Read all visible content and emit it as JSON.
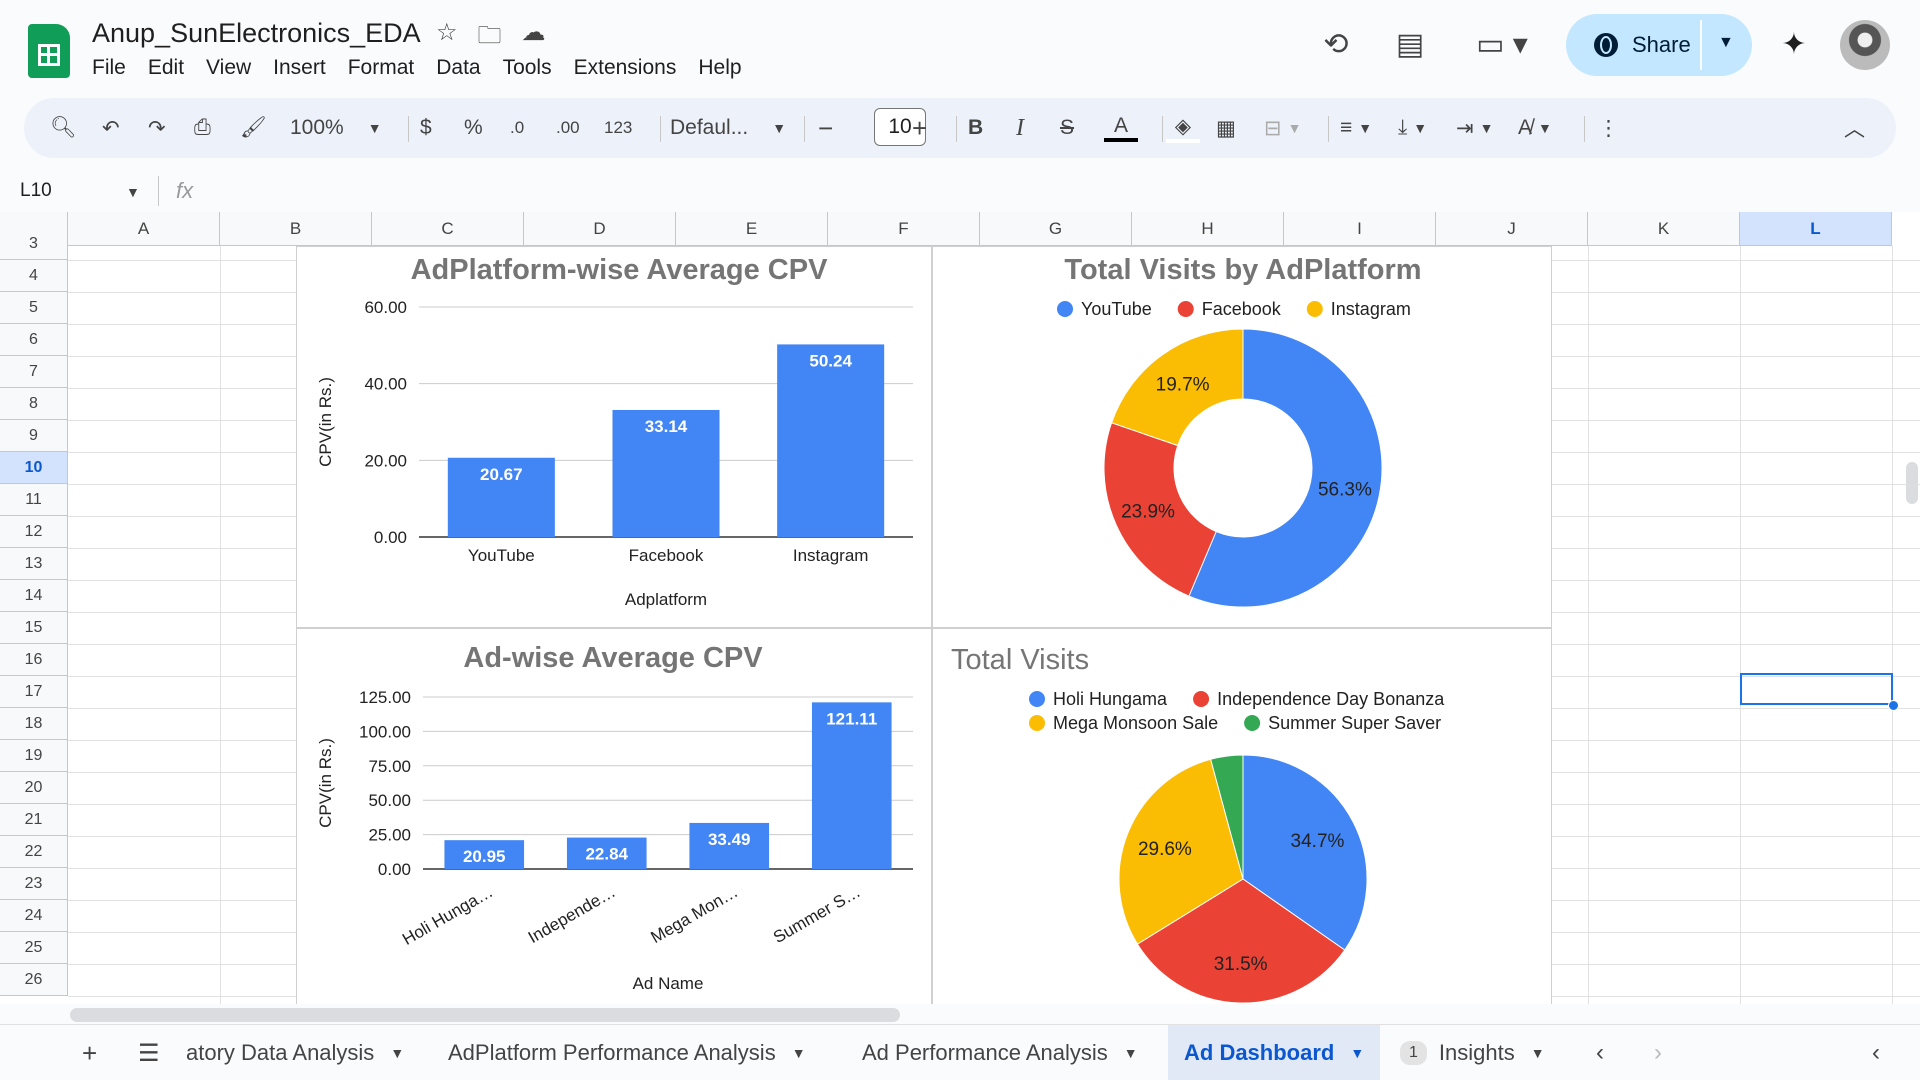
{
  "app": {
    "title": "Anup_SunElectronics_EDA",
    "menu": [
      "File",
      "Edit",
      "View",
      "Insert",
      "Format",
      "Data",
      "Tools",
      "Extensions",
      "Help"
    ],
    "share_label": "Share"
  },
  "toolbar": {
    "zoom": "100%",
    "currency": "$",
    "percent": "%",
    "dec_decrease": ".0",
    "dec_increase": ".00",
    "number_format": "123",
    "font": "Defaul...",
    "font_size": "10",
    "bold": "B",
    "italic": "I",
    "text_color_icon": "A"
  },
  "formula_bar": {
    "name_box": "L10",
    "fx": "fx"
  },
  "grid": {
    "columns": [
      "A",
      "B",
      "C",
      "D",
      "E",
      "F",
      "G",
      "H",
      "I",
      "J",
      "K",
      "L"
    ],
    "rows": [
      "3",
      "4",
      "5",
      "6",
      "7",
      "8",
      "9",
      "10",
      "11",
      "12",
      "13",
      "14",
      "15",
      "16",
      "17",
      "18",
      "19",
      "20",
      "21",
      "22",
      "23",
      "24",
      "25",
      "26"
    ],
    "active_col": "L",
    "active_row": "10"
  },
  "chart_data": [
    {
      "type": "bar",
      "title": "AdPlatform-wise Average CPV",
      "xlabel": "Adplatform",
      "ylabel": "CPV(in Rs.)",
      "categories": [
        "YouTube",
        "Facebook",
        "Instagram"
      ],
      "values": [
        20.67,
        33.14,
        50.24
      ],
      "value_labels": [
        "20.67",
        "33.14",
        "50.24"
      ],
      "yticks": [
        "0.00",
        "20.00",
        "40.00",
        "60.00"
      ],
      "ylim": [
        0,
        60
      ],
      "color": "#4285f4",
      "grid": true
    },
    {
      "type": "pie",
      "donut": true,
      "title": "Total Visits by AdPlatform",
      "legend_position": "top",
      "labels": [
        "YouTube",
        "Facebook",
        "Instagram"
      ],
      "values": [
        56.3,
        23.9,
        19.7
      ],
      "value_labels": [
        "56.3%",
        "23.9%",
        "19.7%"
      ],
      "colors": [
        "#4285f4",
        "#ea4335",
        "#fbbc04"
      ]
    },
    {
      "type": "bar",
      "title": "Ad-wise Average CPV",
      "xlabel": "Ad Name",
      "ylabel": "CPV(in Rs.)",
      "categories": [
        "Holi Hunga…",
        "Independe…",
        "Mega Mon…",
        "Summer S…"
      ],
      "values": [
        20.95,
        22.84,
        33.49,
        121.11
      ],
      "value_labels": [
        "20.95",
        "22.84",
        "33.49",
        "121.11"
      ],
      "yticks": [
        "0.00",
        "25.00",
        "50.00",
        "75.00",
        "100.00",
        "125.00"
      ],
      "ylim": [
        0,
        125
      ],
      "color": "#4285f4",
      "grid": true
    },
    {
      "type": "pie",
      "donut": false,
      "title": "Total Visits",
      "legend_position": "top",
      "labels": [
        "Holi Hungama",
        "Independence Day Bonanza",
        "Mega Monsoon Sale",
        "Summer Super Saver"
      ],
      "values": [
        34.7,
        31.5,
        29.6,
        4.2
      ],
      "value_labels": [
        "34.7%",
        "31.5%",
        "29.6%",
        ""
      ],
      "colors": [
        "#4285f4",
        "#ea4335",
        "#fbbc04",
        "#34a853"
      ]
    }
  ],
  "sheet_tabs": {
    "tabs": [
      "atory Data Analysis",
      "AdPlatform Performance Analysis",
      "Ad Performance Analysis",
      "Ad Dashboard",
      "Insights"
    ],
    "active": "Ad Dashboard",
    "insights_badge": "1"
  }
}
